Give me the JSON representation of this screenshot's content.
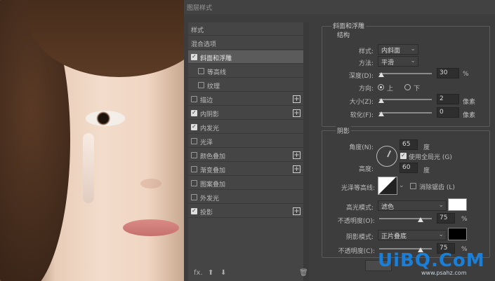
{
  "dialog": {
    "title": "图层样式"
  },
  "left_panel": {
    "items": [
      {
        "label": "样式",
        "checkbox": false,
        "plus": false,
        "selected": false,
        "checked": false,
        "indent": false
      },
      {
        "label": "混合选项",
        "checkbox": false,
        "plus": false,
        "selected": false,
        "checked": false,
        "indent": false
      },
      {
        "label": "斜面和浮雕",
        "checkbox": true,
        "plus": false,
        "selected": true,
        "checked": true,
        "indent": false
      },
      {
        "label": "等高线",
        "checkbox": true,
        "plus": false,
        "selected": false,
        "checked": false,
        "indent": true
      },
      {
        "label": "纹理",
        "checkbox": true,
        "plus": false,
        "selected": false,
        "checked": false,
        "indent": true
      },
      {
        "label": "描边",
        "checkbox": true,
        "plus": true,
        "selected": false,
        "checked": false,
        "indent": false
      },
      {
        "label": "内阴影",
        "checkbox": true,
        "plus": true,
        "selected": false,
        "checked": true,
        "indent": false
      },
      {
        "label": "内发光",
        "checkbox": true,
        "plus": false,
        "selected": false,
        "checked": true,
        "indent": false
      },
      {
        "label": "光泽",
        "checkbox": true,
        "plus": false,
        "selected": false,
        "checked": false,
        "indent": false
      },
      {
        "label": "颜色叠加",
        "checkbox": true,
        "plus": true,
        "selected": false,
        "checked": false,
        "indent": false
      },
      {
        "label": "渐变叠加",
        "checkbox": true,
        "plus": true,
        "selected": false,
        "checked": false,
        "indent": false
      },
      {
        "label": "图案叠加",
        "checkbox": true,
        "plus": false,
        "selected": false,
        "checked": false,
        "indent": false
      },
      {
        "label": "外发光",
        "checkbox": true,
        "plus": false,
        "selected": false,
        "checked": false,
        "indent": false
      },
      {
        "label": "投影",
        "checkbox": true,
        "plus": true,
        "selected": false,
        "checked": true,
        "indent": false
      }
    ],
    "bottom": {
      "fx": "fx.",
      "up": "⬆",
      "down": "⬇",
      "trash": "🗑"
    }
  },
  "bevel": {
    "group_title": "斜面和浮雕",
    "structure_title": "结构",
    "style_label": "样式:",
    "style_value": "内斜面",
    "technique_label": "方法:",
    "technique_value": "平滑",
    "depth_label": "深度(D):",
    "depth_value": "30",
    "depth_unit": "%",
    "direction_label": "方向:",
    "direction_up": "上",
    "direction_down": "下",
    "size_label": "大小(Z):",
    "size_value": "2",
    "size_unit": "像素",
    "soften_label": "软化(F):",
    "soften_value": "0",
    "soften_unit": "像素"
  },
  "shading": {
    "title": "阴影",
    "angle_label": "角度(N):",
    "angle_value": "65",
    "angle_unit": "度",
    "global_light_label": "使用全局光 (G)",
    "altitude_label": "高度:",
    "altitude_value": "60",
    "altitude_unit": "度",
    "gloss_label": "光泽等高线:",
    "antialias_label": "消除锯齿 (L)",
    "highlight_label": "高光模式:",
    "highlight_value": "滤色",
    "highlight_color": "#ffffff",
    "hl_opacity_label": "不透明度(O):",
    "hl_opacity_value": "75",
    "hl_opacity_unit": "%",
    "shadow_label": "阴影模式:",
    "shadow_value": "正片叠底",
    "shadow_color": "#000000",
    "sh_opacity_label": "不透明度(C):",
    "sh_opacity_value": "75",
    "sh_opacity_unit": "%"
  },
  "watermark": {
    "main": "UiBQ.CoM",
    "sub": "www.psahz.com"
  }
}
